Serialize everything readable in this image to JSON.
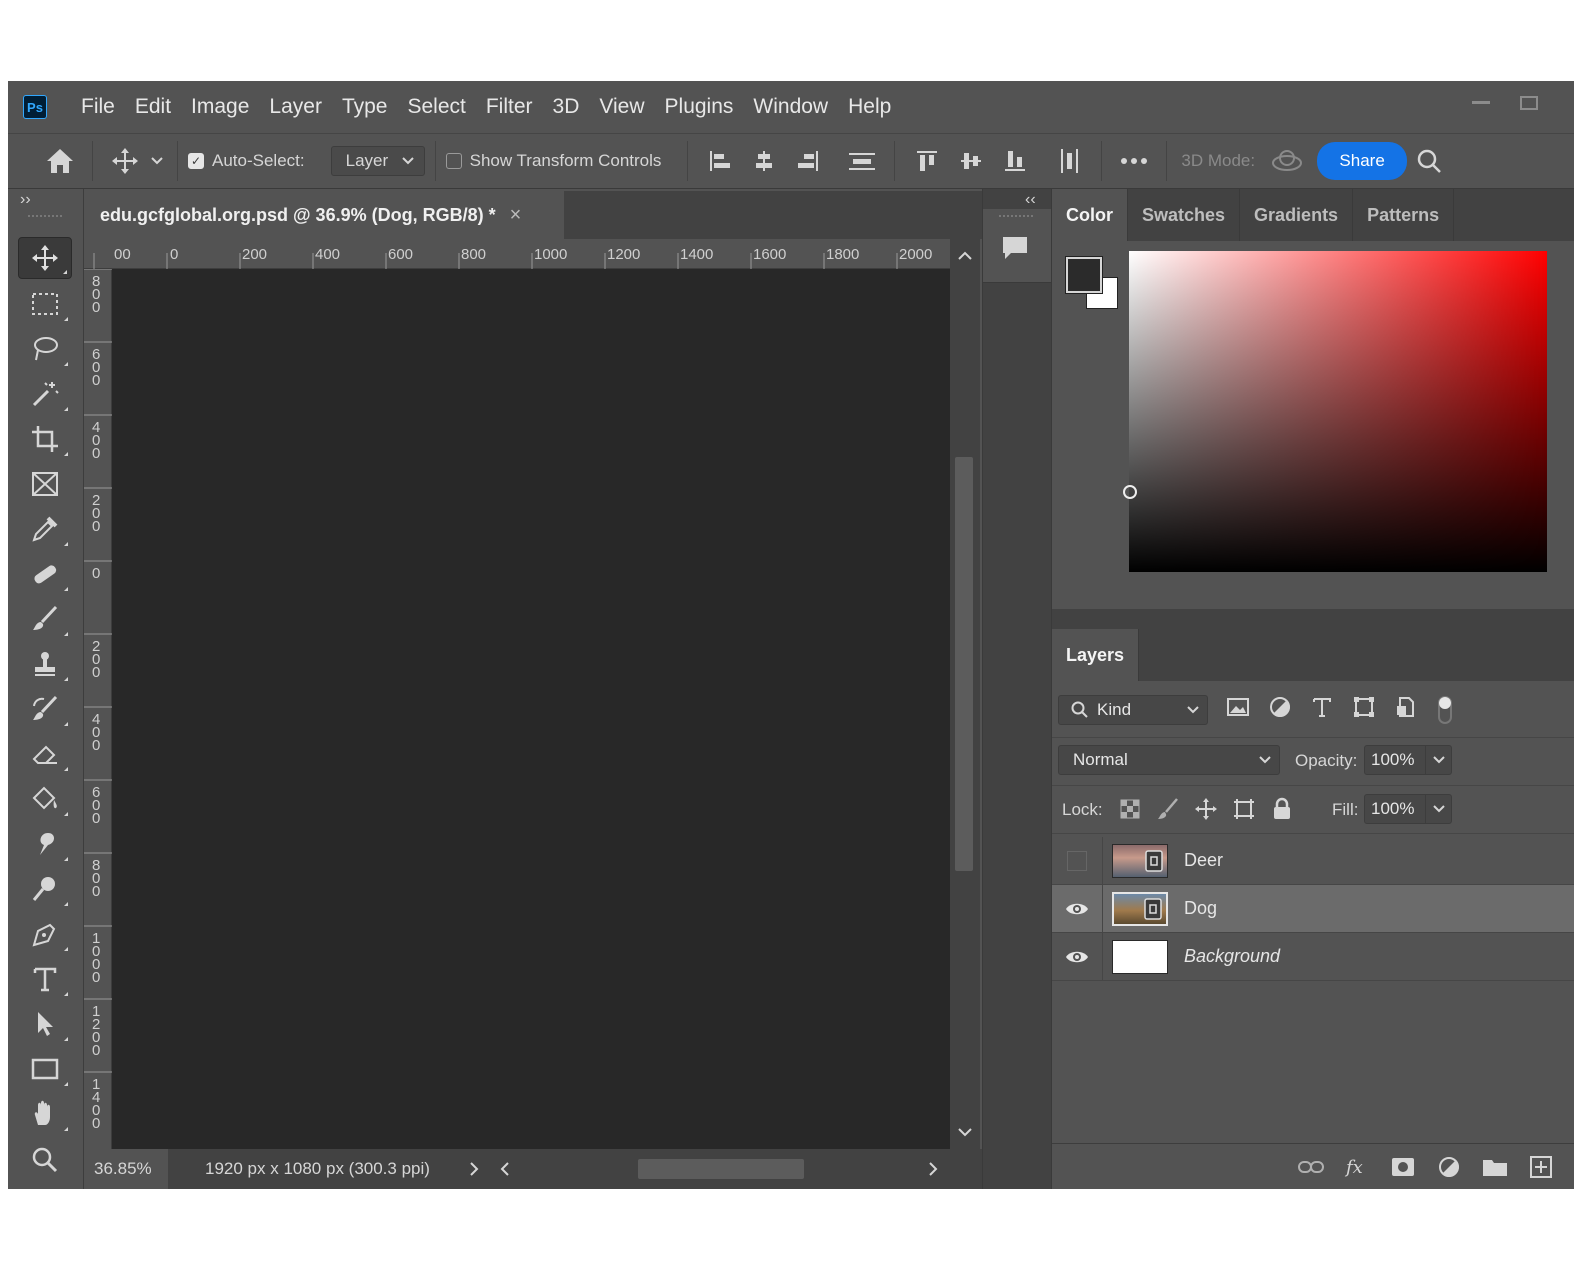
{
  "app": {
    "logo": "Ps"
  },
  "menu": [
    "File",
    "Edit",
    "Image",
    "Layer",
    "Type",
    "Select",
    "Filter",
    "3D",
    "View",
    "Plugins",
    "Window",
    "Help"
  ],
  "options": {
    "auto_select_label": "Auto-Select:",
    "auto_select_value": "Layer",
    "show_transform_label": "Show Transform Controls",
    "mode_3d_label": "3D Mode:",
    "share_label": "Share"
  },
  "document": {
    "tab_title": "edu.gcfglobal.org.psd @ 36.9% (Dog, RGB/8) *",
    "close_glyph": "×",
    "ruler_top": [
      "00",
      "0",
      "200",
      "400",
      "600",
      "800",
      "1000",
      "1200",
      "1400",
      "1600",
      "1800",
      "2000"
    ],
    "ruler_left": [
      "800",
      "600",
      "400",
      "200",
      "0",
      "200",
      "400",
      "600",
      "800",
      "1000",
      "1200",
      "1400"
    ],
    "zoom": "36.85%",
    "size_info": "1920 px x 1080 px (300.3 ppi)"
  },
  "color_panel": {
    "tabs": [
      "Color",
      "Swatches",
      "Gradients",
      "Patterns"
    ],
    "foreground": "#2b2b2b",
    "background": "#ffffff"
  },
  "layers_panel": {
    "tab": "Layers",
    "filter_kind": "Kind",
    "blend_mode": "Normal",
    "opacity_label": "Opacity:",
    "opacity_value": "100%",
    "lock_label": "Lock:",
    "fill_label": "Fill:",
    "fill_value": "100%",
    "layers": [
      {
        "name": "Deer",
        "visible": false,
        "selected": false
      },
      {
        "name": "Dog",
        "visible": true,
        "selected": true
      },
      {
        "name": "Background",
        "visible": true,
        "selected": false
      }
    ]
  }
}
